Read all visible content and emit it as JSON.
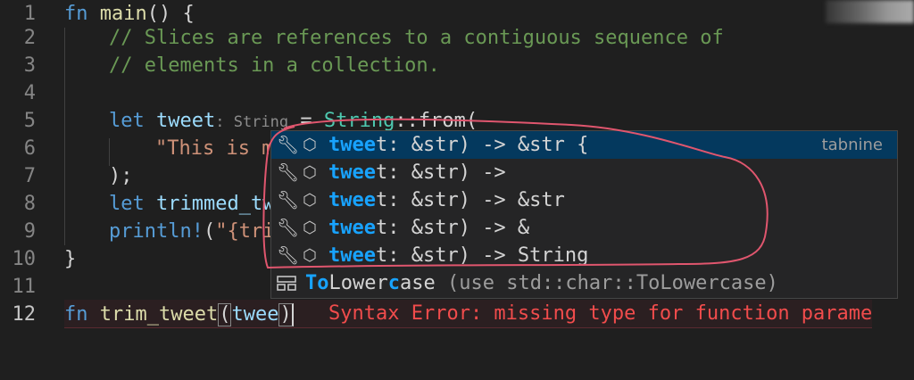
{
  "editor": {
    "lines": [
      {
        "num": "1"
      },
      {
        "num": "2"
      },
      {
        "num": "3"
      },
      {
        "num": "4"
      },
      {
        "num": "5"
      },
      {
        "num": "6"
      },
      {
        "num": "7"
      },
      {
        "num": "8"
      },
      {
        "num": "9"
      },
      {
        "num": "10"
      },
      {
        "num": "11"
      },
      {
        "num": "12"
      }
    ],
    "l1": {
      "kw": "fn",
      "name": "main",
      "rest": "() {"
    },
    "l2": {
      "comment": "// Slices are references to a contiguous sequence of"
    },
    "l3": {
      "comment": "// elements in a collection."
    },
    "l5": {
      "kw": "let",
      "var": "tweet",
      "hint": ": String",
      "eq": " = ",
      "type": "String",
      "call": "::from("
    },
    "l6": {
      "str": "\"This is m"
    },
    "l7": {
      "text": ");"
    },
    "l8": {
      "kw": "let",
      "var": "trimmed_tw"
    },
    "l9": {
      "macro": "println!",
      "open": "(",
      "str": "\"{tri"
    },
    "l10": {
      "text": "}"
    },
    "l12": {
      "kw": "fn",
      "name": "trim_tweet",
      "open": "(",
      "arg": "twee",
      "close": ")"
    },
    "error_message": "Syntax Error: missing type for function paramet"
  },
  "suggestions": {
    "items": [
      {
        "match": "twee",
        "rest": "t: &str) -> &str {",
        "detail": "tabnine",
        "icon": "wrench-icon",
        "selected": true
      },
      {
        "match": "twee",
        "rest": "t: &str) ->",
        "detail": "",
        "icon": "wrench-icon",
        "selected": false
      },
      {
        "match": "twee",
        "rest": "t: &str) -> &str",
        "detail": "",
        "icon": "wrench-icon",
        "selected": false
      },
      {
        "match": "twee",
        "rest": "t: &str) -> &",
        "detail": "",
        "icon": "wrench-icon",
        "selected": false
      },
      {
        "match": "twee",
        "rest": "t: &str) -> String",
        "detail": "",
        "icon": "wrench-icon",
        "selected": false
      }
    ],
    "struct_item": {
      "match1": "To",
      "plain1": "Lower",
      "match2": "c",
      "plain2": "ase",
      "detail": " (use std::char::ToLowercase)",
      "icon": "struct-icon"
    }
  },
  "colors": {
    "background": "#1f1f1f",
    "keyword": "#569cd6",
    "function": "#dcdcaa",
    "comment": "#6a9955",
    "error": "#f14c4c",
    "match_highlight": "#18a3ff",
    "selection": "#04395e",
    "annotation": "#e0566e"
  }
}
